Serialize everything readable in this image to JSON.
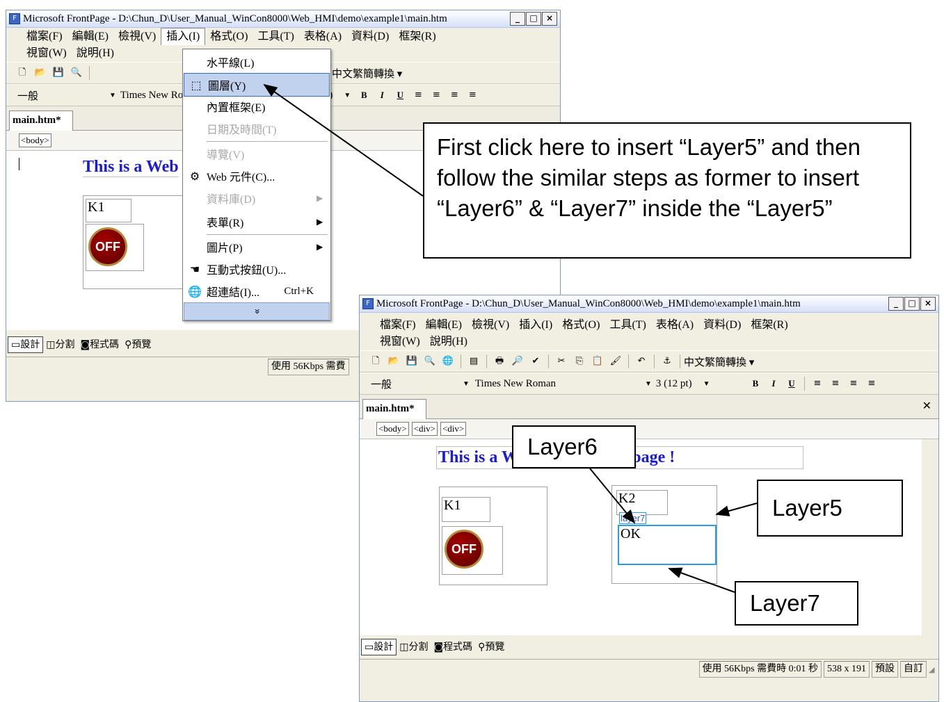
{
  "app_title": "Microsoft FrontPage - D:\\Chun_D\\User_Manual_WinCon8000\\Web_HMI\\demo\\example1\\main.htm",
  "app_icon": "frontpage-app-icon",
  "window_buttons": {
    "minimize": "_",
    "maximize": "□",
    "close": "×"
  },
  "menu": {
    "file": "檔案(F)",
    "edit": "編輯(E)",
    "view": "檢視(V)",
    "insert": "插入(I)",
    "format": "格式(O)",
    "tools": "工具(T)",
    "table": "表格(A)",
    "data": "資料(D)",
    "frames": "框架(R)",
    "window": "視窗(W)",
    "help": "說明(H)"
  },
  "toolbar": {
    "chinese_convert": "中文繁簡轉換 ▾",
    "style_value": "一般",
    "font_value": "Times New Roman",
    "font_value_short": "Times New Ro",
    "size_value": "3  (12 pt)",
    "size_value_short": "t)",
    "bold": "B",
    "italic": "I",
    "underline": "U"
  },
  "document_tab": "main.htm*",
  "tag_selector_1": [
    "<body>"
  ],
  "tag_selector_2": [
    "<body>",
    "<div>",
    "<div>"
  ],
  "page": {
    "heading": "This is a Web HMI sample page !",
    "heading_short": "This is a Web",
    "k1_label": "K1",
    "off_button": "OFF",
    "k2_label": "K2",
    "layer7_badge": "layer7",
    "ok_label": "OK"
  },
  "view_tabs": {
    "design": "設計",
    "split": "分割",
    "code": "程式碼",
    "preview": "預覽"
  },
  "status": {
    "download": "使用 56Kbps 需費時 0:01 秒",
    "download_short": "使用 56Kbps 需費",
    "size": "538 x 191",
    "mode1": "預設",
    "mode2": "自訂"
  },
  "insert_menu": {
    "items": [
      {
        "label": "水平線(L)",
        "icon": "",
        "state": "normal"
      },
      {
        "label": "圖層(Y)",
        "icon": "layer-icon",
        "state": "highlighted"
      },
      {
        "label": "內置框架(E)",
        "icon": "",
        "state": "normal"
      },
      {
        "label": "日期及時間(T)",
        "icon": "",
        "state": "disabled"
      },
      {
        "label": "導覽(V)",
        "icon": "",
        "state": "disabled"
      },
      {
        "label": "Web 元件(C)...",
        "icon": "web-component-icon",
        "state": "normal"
      },
      {
        "label": "資料庫(D)",
        "icon": "",
        "state": "disabled",
        "submenu": true
      },
      {
        "label": "表單(R)",
        "icon": "",
        "state": "normal",
        "submenu": true
      },
      {
        "label": "圖片(P)",
        "icon": "",
        "state": "normal",
        "submenu": true
      },
      {
        "label": "互動式按鈕(U)...",
        "icon": "interactive-button-icon",
        "state": "normal"
      },
      {
        "label": "超連結(I)...",
        "shortcut": "Ctrl+K",
        "icon": "hyperlink-icon",
        "state": "normal"
      }
    ],
    "expand": "»"
  },
  "callouts": {
    "main": "First click here to insert “Layer5” and then follow the similar steps as former to insert “Layer6” & “Layer7” inside the “Layer5”",
    "layer6": "Layer6",
    "layer5": "Layer5",
    "layer7": "Layer7"
  },
  "colors": {
    "heading_blue": "#1a1adb",
    "menu_highlight": "#c1d2ee",
    "layer7_border": "#2a9de0",
    "off_button_red": "#8b0000"
  }
}
